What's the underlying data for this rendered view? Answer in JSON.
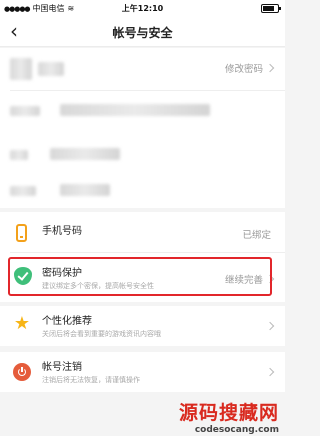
{
  "status_bar": {
    "carrier": "中国电信",
    "time": "上午12:10"
  },
  "nav": {
    "title": "帐号与安全"
  },
  "account": {
    "change_password_label": "修改密码"
  },
  "items": {
    "phone": {
      "label": "手机号码",
      "status": "已绑定"
    },
    "password_protect": {
      "label": "密码保护",
      "subtitle": "建议绑定多个密保，提高帐号安全性",
      "status": "继续完善"
    },
    "personalize": {
      "label": "个性化推荐",
      "subtitle": "关闭后将会看到重要的游戏资讯内容哦"
    },
    "cancel_account": {
      "label": "帐号注销",
      "subtitle": "注销后将无法恢复，请谨慎操作"
    }
  },
  "watermark": {
    "title": "源码搜藏网",
    "url": "codesocang.com"
  },
  "colors": {
    "highlight": "#e2262b",
    "shield": "#3fbf7a",
    "phone_icon": "#f3a11b",
    "star": "#f7b516",
    "power": "#e55c3b"
  }
}
